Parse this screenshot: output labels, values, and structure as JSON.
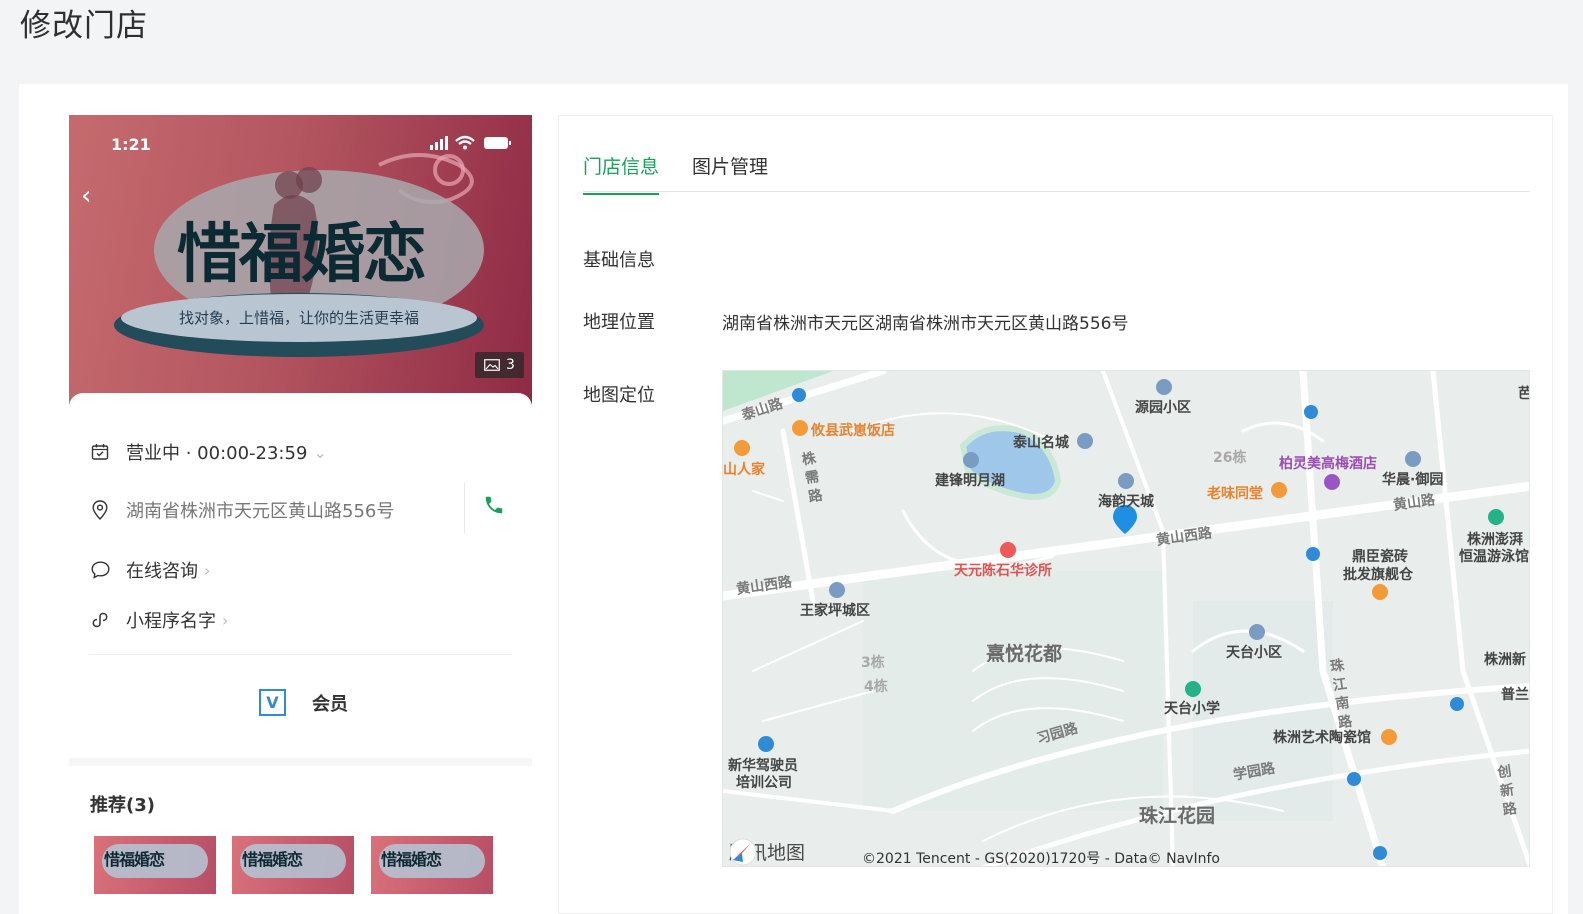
{
  "page": {
    "title": "修改门店"
  },
  "phone_preview": {
    "status_time": "1:21",
    "brand_title": "惜福婚恋",
    "brand_slogan": "找对象，上惜福，让你的生活更幸福",
    "photo_count": "3",
    "business_status": "营业中 · 00:00-23:59",
    "address": "湖南省株洲市天元区黄山路556号",
    "online_consult": "在线咨询",
    "mini_program": "小程序名字",
    "member_badge": "V",
    "member_label": "会员",
    "recommend_title": "推荐(3)",
    "thumb_text": "惜福婚恋"
  },
  "tabs": [
    {
      "label": "门店信息",
      "active": true
    },
    {
      "label": "图片管理",
      "active": false
    }
  ],
  "store_info": {
    "section_basic": "基础信息",
    "location_label": "地理位置",
    "location_value": "湖南省株洲市天元区湖南省株洲市天元区黄山路556号",
    "map_label": "地图定位"
  },
  "map": {
    "brand": "腾讯地图",
    "copyright": "©2021 Tencent - GS(2020)1720号 - Data© NavInfo",
    "labels": {
      "yuanyuan": "源园小区",
      "taishan_mingcheng": "泰山名城",
      "jianfeng": "建锋明月湖",
      "haiyun": "海韵天城",
      "building26": "26栋",
      "bailing": "柏灵美高梅酒店",
      "huachen": "华晨·御园",
      "laowei": "老味同堂",
      "youxian": "攸县武崽饭店",
      "shanrenjia": "山人家",
      "tianyuan_clinic": "天元陈石华诊所",
      "wangjiaping": "王家坪城区",
      "xiyue": "熹悦花都",
      "building3": "3栋",
      "building4": "4栋",
      "tiantai_xiaoqu": "天台小区",
      "tiantai_school": "天台小学",
      "dingchen": "鼎臣瓷砖",
      "dingchen2": "批发旗舰仓",
      "zhuzhou_pengpai": "株洲澎湃",
      "hengwen": "恒温游泳馆",
      "zhuzhou_xin": "株洲新",
      "pula": "普兰",
      "art_museum": "株洲艺术陶瓷馆",
      "xinhua": "新华驾驶员",
      "xinhua2": "培训公司",
      "zhujiang": "珠江花园",
      "corner": "芭"
    },
    "roads": {
      "taishan": "泰山路",
      "zhuchu": "株 需 路",
      "huangshan_xi1": "黄山西路",
      "huangshan_xi2": "黄山西路",
      "huangshan": "黄山路",
      "xiyuan": "习园路",
      "xueyuan": "学园路",
      "zhujiang_nan": "珠 江 南 路",
      "chuangxin": "创 新 路"
    }
  },
  "colors": {
    "accent": "#19a05a",
    "map_pin": "#1e8fe3",
    "member_blue": "#2f8ad8"
  }
}
